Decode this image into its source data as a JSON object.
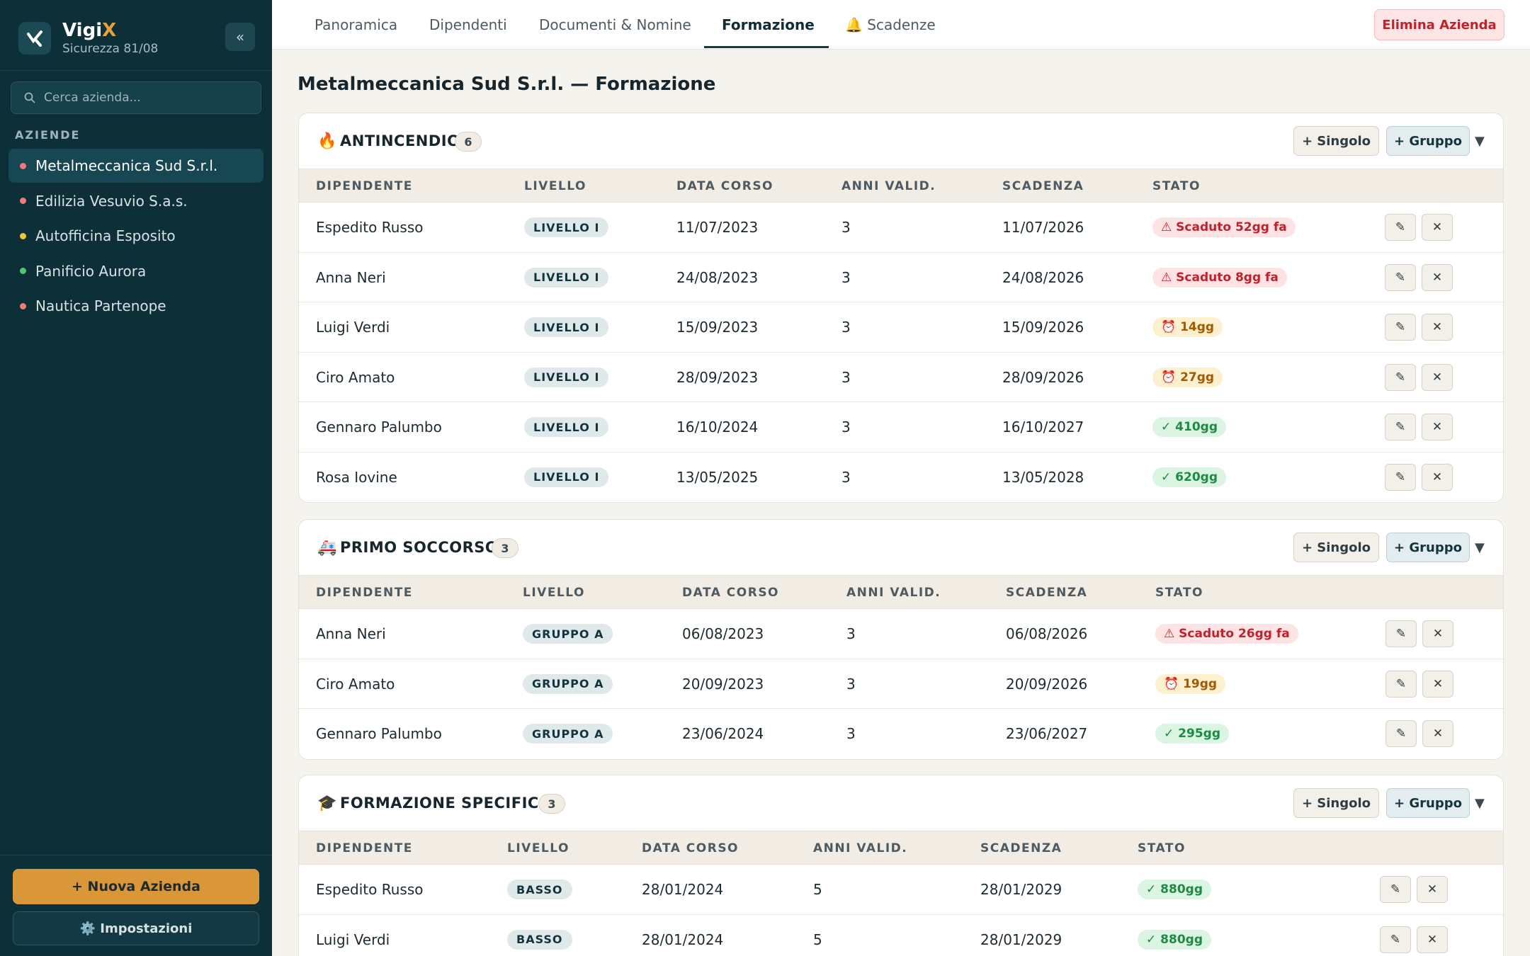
{
  "brand": {
    "name": "Vigi",
    "name_accent": "X",
    "subtitle": "Sicurezza 81/08",
    "collapse": "«"
  },
  "sidebar": {
    "search_placeholder": "Cerca azienda...",
    "section_title": "AZIENDE",
    "companies": [
      {
        "name": "Metalmeccanica Sud S.r.l.",
        "status_color": "#f07b7b"
      },
      {
        "name": "Edilizia Vesuvio S.a.s.",
        "status_color": "#f07b7b"
      },
      {
        "name": "Autofficina Esposito",
        "status_color": "#f3c43c"
      },
      {
        "name": "Panificio Aurora",
        "status_color": "#4cc77a"
      },
      {
        "name": "Nautica Partenope",
        "status_color": "#f07b7b"
      }
    ],
    "new_company": "+ Nuova Azienda",
    "settings": "⚙️ Impostazioni"
  },
  "tabs": [
    {
      "label": "Panoramica"
    },
    {
      "label": "Dipendenti"
    },
    {
      "label": "Documenti & Nomine"
    },
    {
      "label": "Formazione",
      "active": true
    },
    {
      "label": "🔔 Scadenze"
    }
  ],
  "delete_company": "Elimina Azienda",
  "page_title": "Metalmeccanica Sud S.r.l. — Formazione",
  "buttons": {
    "single": "+ Singolo",
    "group": "+ Gruppo",
    "edit": "✎",
    "remove": "✕",
    "chevron": "▼"
  },
  "columns": [
    "DIPENDENTE",
    "LIVELLO",
    "DATA CORSO",
    "ANNI VALID.",
    "SCADENZA",
    "STATO"
  ],
  "sections": [
    {
      "icon": "🔥",
      "title": "ANTINCENDIO",
      "count": "6",
      "rows": [
        [
          "Espedito Russo",
          "LIVELLO I",
          "11/07/2023",
          "3",
          "11/07/2026",
          "⚠ Scaduto 52gg fa",
          "red"
        ],
        [
          "Anna Neri",
          "LIVELLO I",
          "24/08/2023",
          "3",
          "24/08/2026",
          "⚠ Scaduto 8gg fa",
          "red"
        ],
        [
          "Luigi Verdi",
          "LIVELLO I",
          "15/09/2023",
          "3",
          "15/09/2026",
          "⏰ 14gg",
          "yel"
        ],
        [
          "Ciro Amato",
          "LIVELLO I",
          "28/09/2023",
          "3",
          "28/09/2026",
          "⏰ 27gg",
          "yel"
        ],
        [
          "Gennaro Palumbo",
          "LIVELLO I",
          "16/10/2024",
          "3",
          "16/10/2027",
          "✓ 410gg",
          "grn"
        ],
        [
          "Rosa Iovine",
          "LIVELLO I",
          "13/05/2025",
          "3",
          "13/05/2028",
          "✓ 620gg",
          "grn"
        ]
      ]
    },
    {
      "icon": "🚑",
      "title": "PRIMO SOCCORSO",
      "count": "3",
      "rows": [
        [
          "Anna Neri",
          "GRUPPO A",
          "06/08/2023",
          "3",
          "06/08/2026",
          "⚠ Scaduto 26gg fa",
          "red"
        ],
        [
          "Ciro Amato",
          "GRUPPO A",
          "20/09/2023",
          "3",
          "20/09/2026",
          "⏰ 19gg",
          "yel"
        ],
        [
          "Gennaro Palumbo",
          "GRUPPO A",
          "23/06/2024",
          "3",
          "23/06/2027",
          "✓ 295gg",
          "grn"
        ]
      ]
    },
    {
      "icon": "🎓",
      "title": "FORMAZIONE SPECIFICA",
      "count": "3",
      "rows": [
        [
          "Espedito Russo",
          "BASSO",
          "28/01/2024",
          "5",
          "28/01/2029",
          "✓ 880gg",
          "grn"
        ],
        [
          "Luigi Verdi",
          "BASSO",
          "28/01/2024",
          "5",
          "28/01/2029",
          "✓ 880gg",
          "grn"
        ]
      ]
    }
  ]
}
